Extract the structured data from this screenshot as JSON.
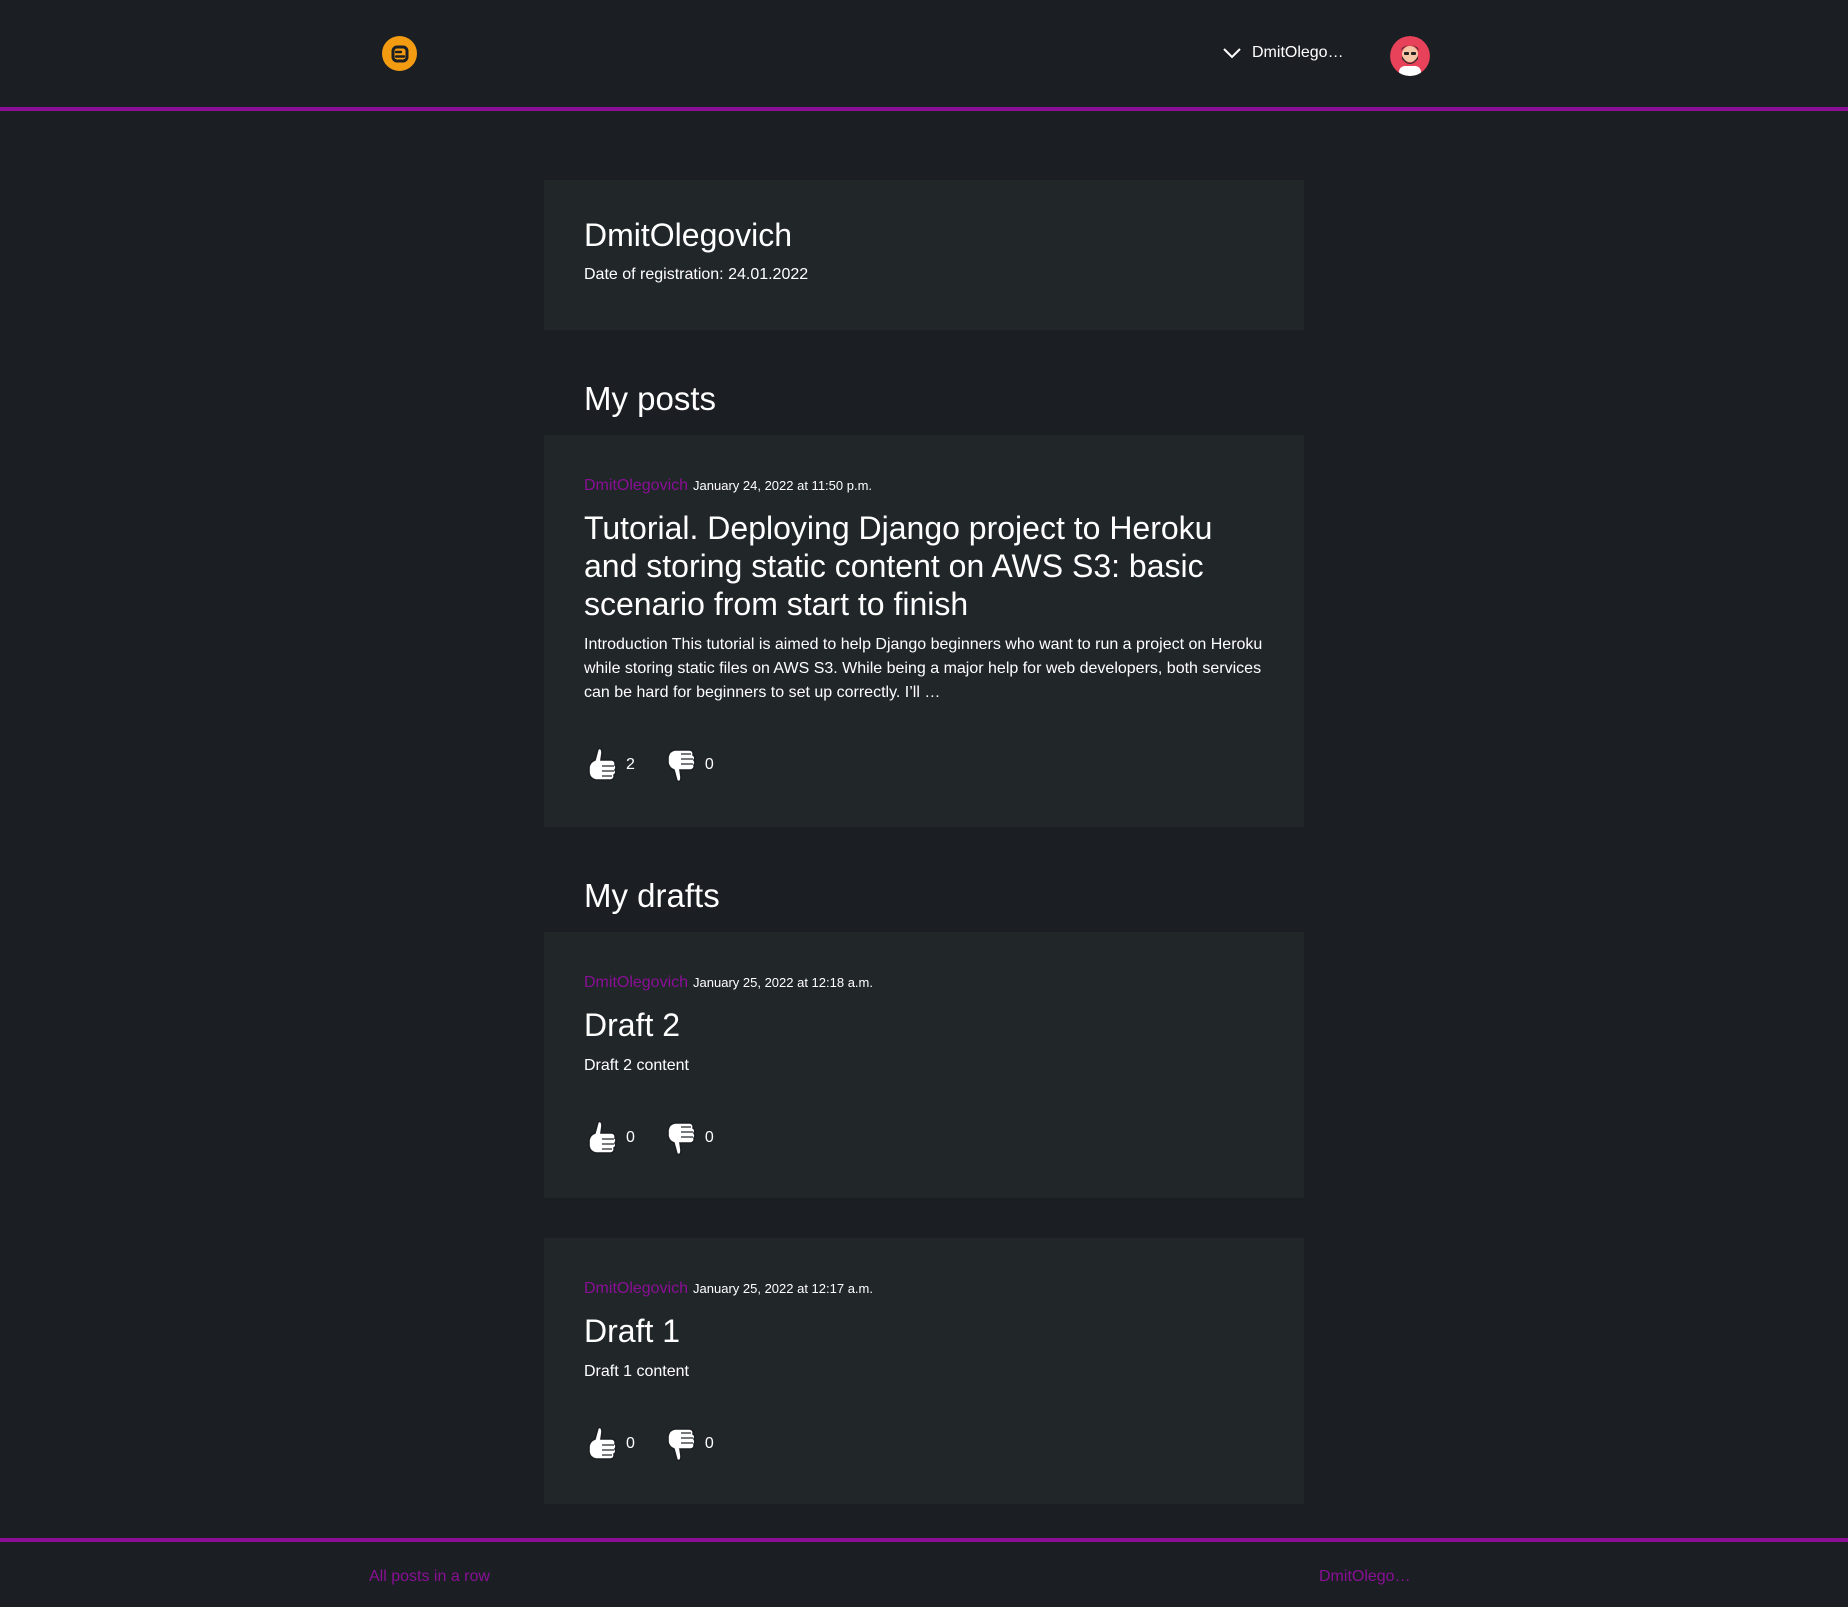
{
  "header": {
    "username_short": "DmitOlego…"
  },
  "profile": {
    "name": "DmitOlegovich",
    "registration": "Date of registration: 24.01.2022"
  },
  "sections": {
    "posts_title": "My posts",
    "drafts_title": "My drafts"
  },
  "posts": [
    {
      "author": "DmitOlegovich",
      "date": "January 24, 2022 at 11:50 p.m.",
      "title": "Tutorial. Deploying Django project to Heroku and storing static content on AWS S3: basic scenario from start to finish",
      "excerpt": "Introduction This tutorial is aimed to help Django beginners who want to run a project on Heroku while storing static files on AWS S3. While being a major help for web developers, both services can be hard for beginners to set up correctly. I’ll …",
      "likes": "2",
      "dislikes": "0"
    }
  ],
  "drafts": [
    {
      "author": "DmitOlegovich",
      "date": "January 25, 2022 at 12:18 a.m.",
      "title": "Draft 2",
      "excerpt": "Draft 2 content",
      "likes": "0",
      "dislikes": "0"
    },
    {
      "author": "DmitOlegovich",
      "date": "January 25, 2022 at 12:17 a.m.",
      "title": "Draft 1",
      "excerpt": "Draft 1 content",
      "likes": "0",
      "dislikes": "0"
    }
  ],
  "footer": {
    "all_posts": "All posts in a row",
    "user": "DmitOlego…"
  },
  "colors": {
    "accent": "#8a0f96",
    "background": "#1b1f23",
    "card": "#212629",
    "logo": "#f39c12"
  },
  "icons": [
    "blogger-logo-icon",
    "chevron-down-icon",
    "avatar-icon",
    "thumbs-up-icon",
    "thumbs-down-icon"
  ]
}
